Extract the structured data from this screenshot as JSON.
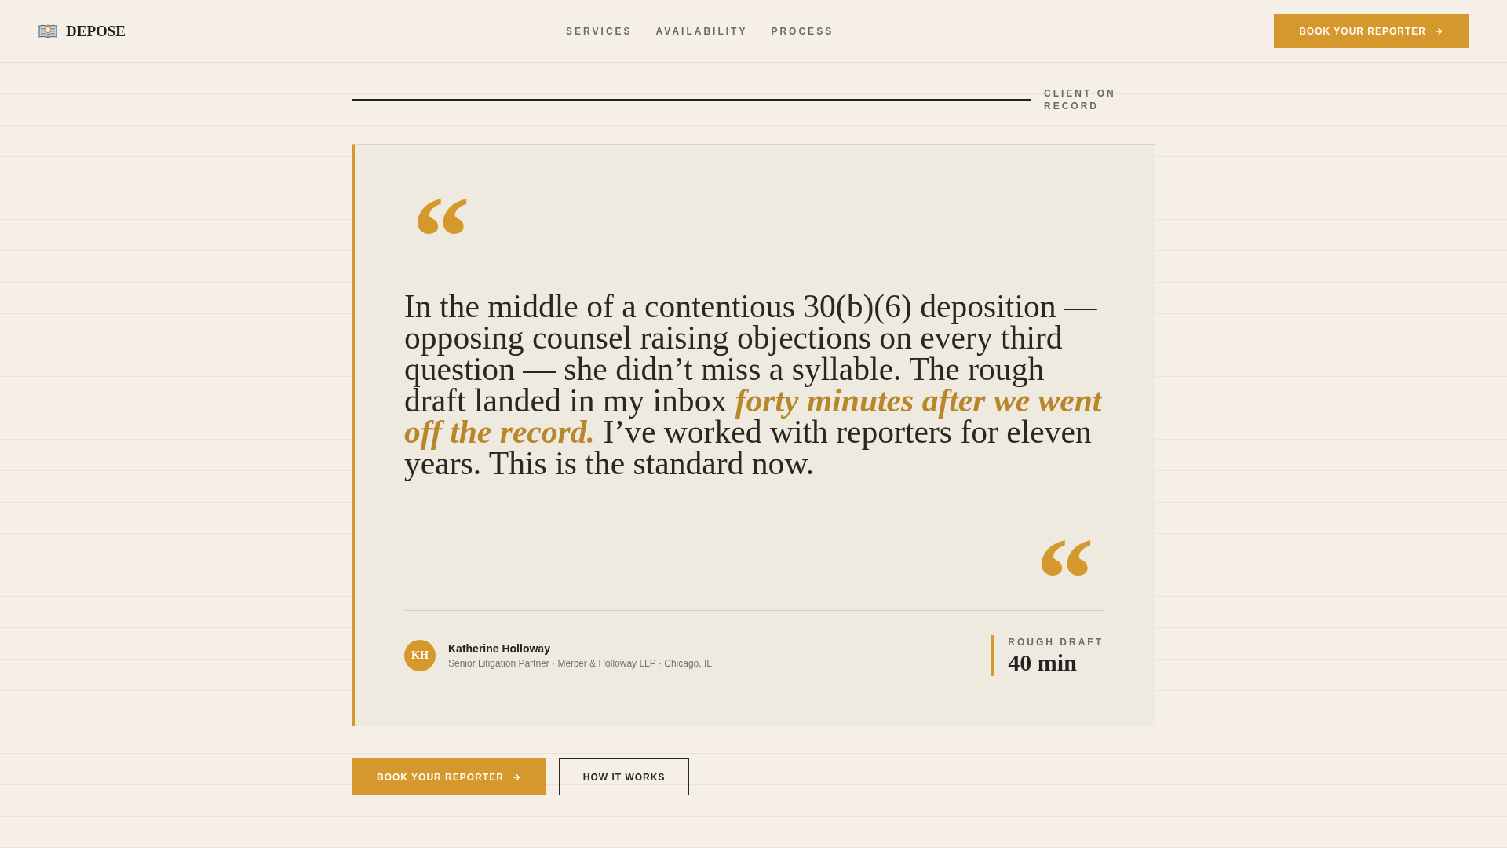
{
  "header": {
    "logo": {
      "text": "DEPOSE"
    },
    "nav": [
      {
        "label": "SERVICES"
      },
      {
        "label": "AVAILABILITY"
      },
      {
        "label": "PROCESS"
      }
    ],
    "cta": {
      "label": "BOOK YOUR REPORTER"
    }
  },
  "section_label": "CLIENT ON RECORD",
  "testimonial": {
    "open_quote": "“",
    "quote": "In the middle of a contentious 30(b)(6) deposition — opposing counsel raising objections on every third question — she didn’t miss a syllable. The rough draft landed in my inbox *forty minutes after we went off the record.* I’ve worked with reporters for eleven years. This is the standard now.",
    "close_quote": "“",
    "author": {
      "initials": "KH",
      "name": "Katherine Holloway",
      "title": "Senior Litigation Partner · Mercer & Holloway LLP · Chicago, IL"
    },
    "stat": {
      "label": "ROUGH DRAFT",
      "value": "40 min"
    }
  },
  "actions": [
    {
      "label": "BOOK YOUR REPORTER",
      "kind": "primary"
    },
    {
      "label": "HOW IT WORKS",
      "kind": "secondary"
    }
  ]
}
